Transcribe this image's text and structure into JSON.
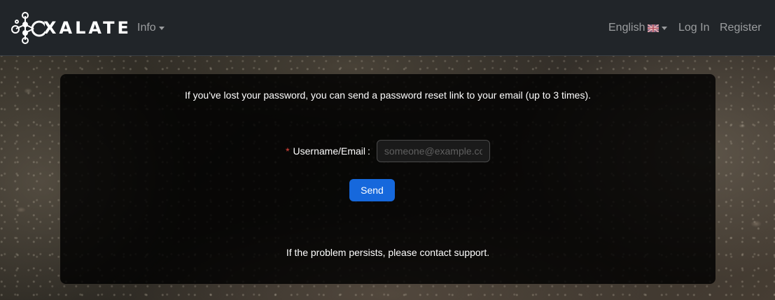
{
  "navbar": {
    "brand": "XALATE",
    "info_label": "Info",
    "language_label": "English",
    "login_label": "Log In",
    "register_label": "Register"
  },
  "reset_form": {
    "intro": "If you've lost your password, you can send a password reset link to your email (up to 3 times).",
    "required_mark": "*",
    "field_label": "Username/Email",
    "field_colon": ":",
    "field_value": "",
    "field_placeholder": "someone@example.com",
    "send_label": "Send",
    "footer_note": "If the problem persists, please contact support."
  },
  "colors": {
    "navbar_bg": "#212529",
    "primary_button": "#1668dc",
    "required_mark": "#e5483e"
  }
}
